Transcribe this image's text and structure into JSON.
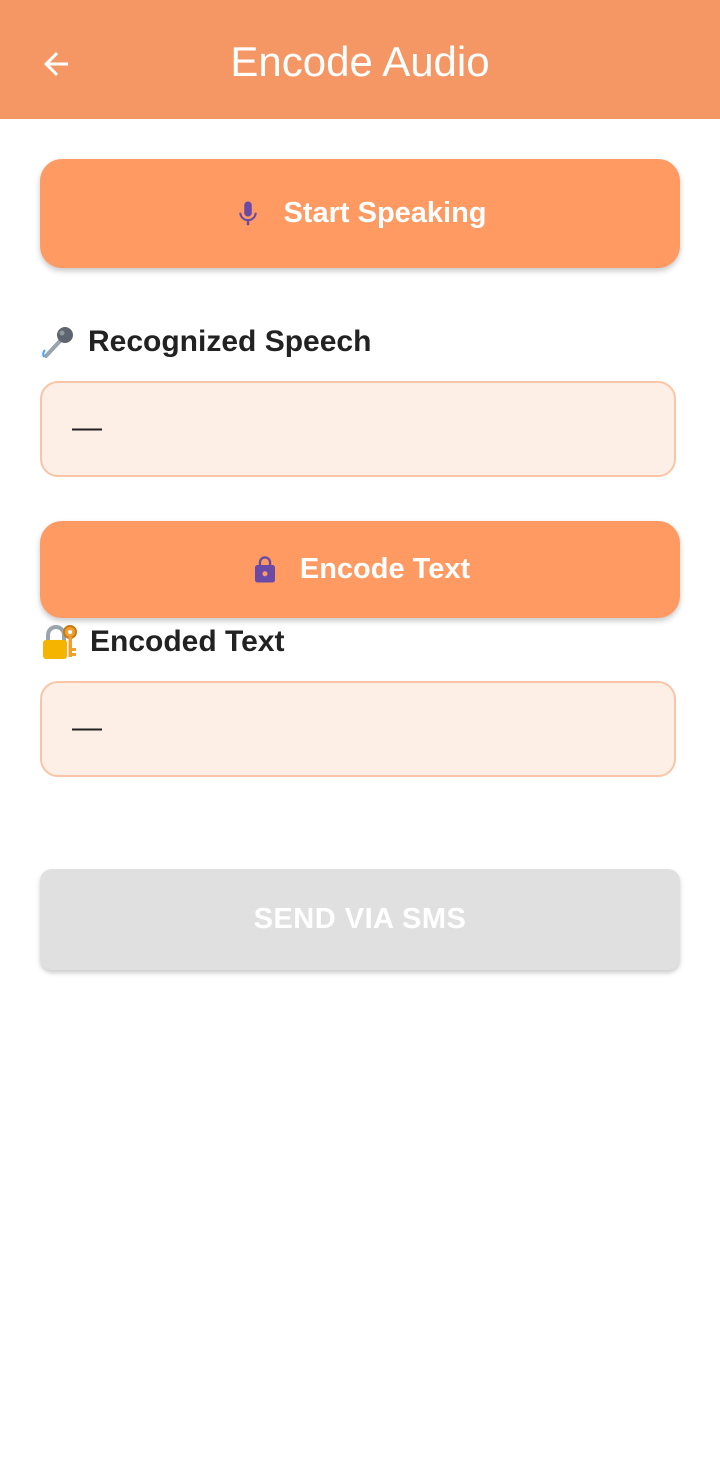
{
  "app_bar": {
    "title": "Encode Audio",
    "back_icon": "arrow-left-icon",
    "background": "#f59765"
  },
  "speak_button": {
    "label": "Start Speaking",
    "icon": "microphone-icon",
    "background": "#ff9a62",
    "icon_color": "#6a4aa6"
  },
  "recognized": {
    "label": "Recognized Speech",
    "emoji": "microphone-emoji",
    "value": "—"
  },
  "encode_button": {
    "label": "Encode Text",
    "icon": "lock-icon",
    "background": "#ff9a62",
    "icon_color": "#6a4aa6"
  },
  "encoded": {
    "label": "Encoded Text",
    "emoji": "lock-with-key-emoji",
    "value": "—"
  },
  "sms_button": {
    "label": "SEND VIA SMS",
    "state": "disabled",
    "background": "#e0e0e0"
  }
}
